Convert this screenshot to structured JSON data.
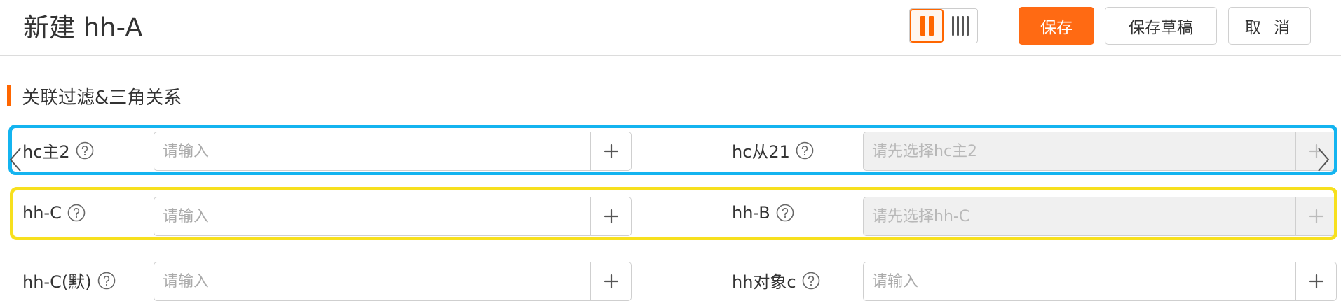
{
  "header": {
    "title": "新建 hh-A",
    "save_label": "保存",
    "draft_label": "保存草稿",
    "cancel_label": "取 消",
    "view_modes": [
      "two-column-icon",
      "four-column-icon"
    ],
    "active_view_mode": "two-column-icon"
  },
  "section": {
    "title": "关联过滤&三角关系"
  },
  "rows": [
    {
      "left": {
        "label": "hc主2",
        "placeholder": "请输入",
        "disabled": false
      },
      "right": {
        "label": "hc从21",
        "placeholder": "请先选择hc主2",
        "disabled": true
      }
    },
    {
      "left": {
        "label": "hh-C",
        "placeholder": "请输入",
        "disabled": false
      },
      "right": {
        "label": "hh-B",
        "placeholder": "请先选择hh-C",
        "disabled": true
      }
    },
    {
      "left": {
        "label": "hh-C(默)",
        "placeholder": "请输入",
        "disabled": false
      },
      "right": {
        "label": "hh对象c",
        "placeholder": "请输入",
        "disabled": false
      }
    }
  ],
  "colors": {
    "accent": "#ff6a13",
    "highlight_blue": "#14b4f0",
    "highlight_yellow": "#f7e01e"
  }
}
